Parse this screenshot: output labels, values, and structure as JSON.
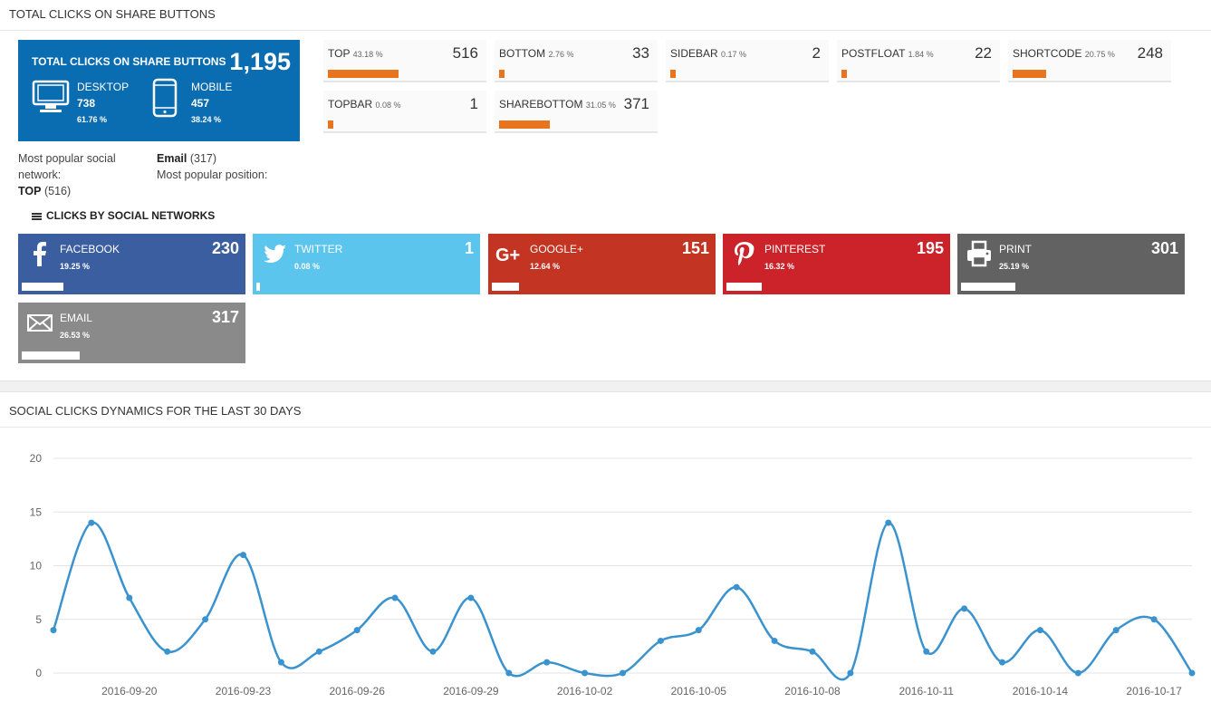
{
  "header": {
    "title": "TOTAL CLICKS ON SHARE BUTTONS"
  },
  "total": {
    "label": "TOTAL CLICKS ON SHARE BUTTONS",
    "value": "1,195",
    "desktop": {
      "label": "DESKTOP",
      "value": "738",
      "percent": "61.76 %",
      "icon": "desktop-icon"
    },
    "mobile": {
      "label": "MOBILE",
      "value": "457",
      "percent": "38.24 %",
      "icon": "mobile-icon"
    },
    "color": "#0b6db1"
  },
  "positions": [
    {
      "label": "TOP",
      "percent": "43.18 %",
      "value": "516",
      "fraction": 0.4318
    },
    {
      "label": "BOTTOM",
      "percent": "2.76 %",
      "value": "33",
      "fraction": 0.0276
    },
    {
      "label": "SIDEBAR",
      "percent": "0.17 %",
      "value": "2",
      "fraction": 0.0017
    },
    {
      "label": "POSTFLOAT",
      "percent": "1.84 %",
      "value": "22",
      "fraction": 0.0184
    },
    {
      "label": "SHORTCODE",
      "percent": "20.75 %",
      "value": "248",
      "fraction": 0.2075
    },
    {
      "label": "TOPBAR",
      "percent": "0.08 %",
      "value": "1",
      "fraction": 0.0008
    },
    {
      "label": "SHAREBOTTOM",
      "percent": "31.05 %",
      "value": "371",
      "fraction": 0.3105
    }
  ],
  "popular": {
    "network_label": "Most popular social network:",
    "network_value": "Email",
    "network_count": "(317)",
    "position_label": "Most popular position:",
    "position_value": "TOP",
    "position_count": "(516)"
  },
  "networks_title": "CLICKS BY SOCIAL NETWORKS",
  "networks": [
    {
      "name": "FACEBOOK",
      "percent": "19.25 %",
      "value": "230",
      "fraction": 0.1925,
      "color": "#3b5ea0",
      "icon": "facebook-icon"
    },
    {
      "name": "TWITTER",
      "percent": "0.08 %",
      "value": "1",
      "fraction": 0.0008,
      "color": "#5bc5ee",
      "icon": "twitter-icon"
    },
    {
      "name": "GOOGLE+",
      "percent": "12.64 %",
      "value": "151",
      "fraction": 0.1264,
      "color": "#c33422",
      "icon": "google-plus-icon"
    },
    {
      "name": "PINTEREST",
      "percent": "16.32 %",
      "value": "195",
      "fraction": 0.1632,
      "color": "#cc2229",
      "icon": "pinterest-icon"
    },
    {
      "name": "PRINT",
      "percent": "25.19 %",
      "value": "301",
      "fraction": 0.2519,
      "color": "#626262",
      "icon": "print-icon"
    },
    {
      "name": "EMAIL",
      "percent": "26.53 %",
      "value": "317",
      "fraction": 0.2653,
      "color": "#8a8a8a",
      "icon": "email-icon"
    }
  ],
  "dynamics_title": "SOCIAL CLICKS DYNAMICS FOR THE LAST 30 DAYS",
  "chart_data": {
    "type": "line",
    "title": "",
    "xlabel": "",
    "ylabel": "",
    "ylim": [
      0,
      20
    ],
    "yticks": [
      "0",
      "5",
      "10",
      "15",
      "20"
    ],
    "x": [
      "2016-09-18",
      "2016-09-19",
      "2016-09-20",
      "2016-09-21",
      "2016-09-22",
      "2016-09-23",
      "2016-09-24",
      "2016-09-25",
      "2016-09-26",
      "2016-09-27",
      "2016-09-28",
      "2016-09-29",
      "2016-09-30",
      "2016-10-01",
      "2016-10-02",
      "2016-10-03",
      "2016-10-04",
      "2016-10-05",
      "2016-10-06",
      "2016-10-07",
      "2016-10-08",
      "2016-10-09",
      "2016-10-10",
      "2016-10-11",
      "2016-10-12",
      "2016-10-13",
      "2016-10-14",
      "2016-10-15",
      "2016-10-16",
      "2016-10-17",
      "2016-10-18"
    ],
    "xtick_labels": [
      "2016-09-20",
      "2016-09-23",
      "2016-09-26",
      "2016-09-29",
      "2016-10-02",
      "2016-10-05",
      "2016-10-08",
      "2016-10-11",
      "2016-10-14",
      "2016-10-17"
    ],
    "series": [
      {
        "values": [
          4,
          14,
          7,
          2,
          5,
          11,
          1,
          2,
          4,
          7,
          2,
          7,
          0,
          1,
          0,
          0,
          3,
          4,
          8,
          3,
          2,
          0,
          14,
          2,
          6,
          1,
          4,
          0,
          4,
          5,
          0
        ],
        "color": "#3a93cf"
      }
    ],
    "grid": true
  }
}
